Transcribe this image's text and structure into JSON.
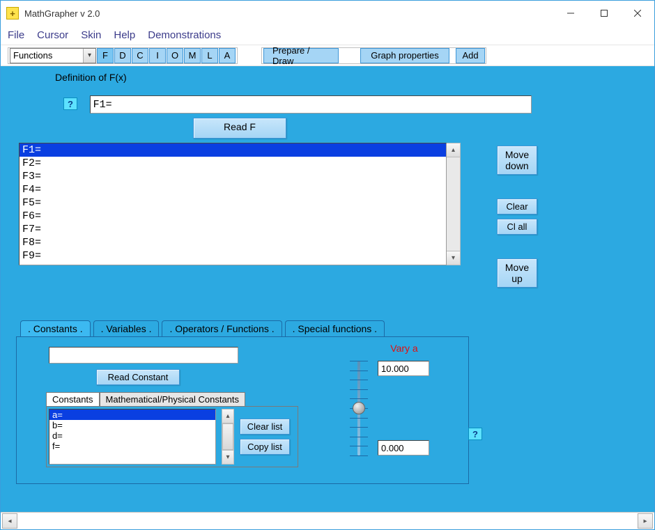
{
  "window": {
    "title": "MathGrapher v 2.0"
  },
  "menubar": [
    "File",
    "Cursor",
    "Skin",
    "Help",
    "Demonstrations"
  ],
  "toolbar": {
    "combo": "Functions",
    "mode_buttons": [
      "F",
      "D",
      "C",
      "I",
      "O",
      "M",
      "L",
      "A"
    ],
    "prepare_draw": "Prepare / Draw",
    "graph_properties": "Graph properties",
    "add": "Add"
  },
  "definition": {
    "label": "Definition of F(x)",
    "help": "?",
    "fx_value": "F1=",
    "read_f": "Read F",
    "f_list": [
      "F1=",
      "F2=",
      "F3=",
      "F4=",
      "F5=",
      "F6=",
      "F7=",
      "F8=",
      "F9="
    ],
    "selected_index": 0,
    "side": {
      "move_down": "Move\ndown",
      "clear": "Clear",
      "clear_all": "Cl all",
      "move_up": "Move\nup"
    }
  },
  "tabs": {
    "items": [
      ". Constants .",
      ". Variables .",
      ". Operators / Functions .",
      ". Special functions ."
    ],
    "active": 0
  },
  "constants": {
    "input": "",
    "read_constant": "Read Constant",
    "subtabs": [
      "Constants",
      "Mathematical/Physical Constants"
    ],
    "sub_active": 0,
    "list": [
      "a=",
      "b=",
      "d=",
      "f="
    ],
    "selected_index": 0,
    "clear_list": "Clear list",
    "copy_list": "Copy list"
  },
  "vary": {
    "label": "Vary a",
    "max": "10.000",
    "min": "0.000",
    "thumb_pct": 50,
    "help": "?"
  }
}
